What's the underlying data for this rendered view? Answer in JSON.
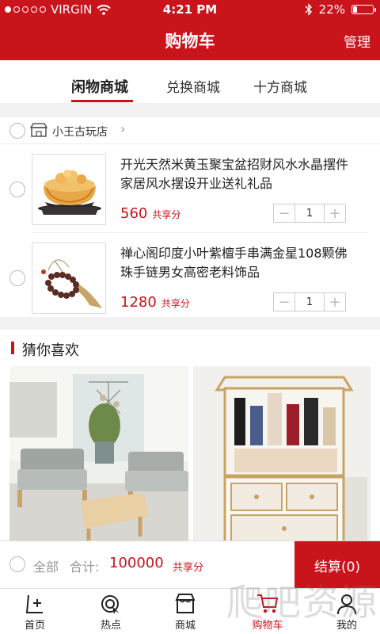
{
  "status_bar": {
    "carrier": "VIRGIN",
    "time": "4:21 PM",
    "battery": "22%",
    "battery_level": 0.22
  },
  "nav": {
    "title": "购物车",
    "manage_label": "管理"
  },
  "tabs": [
    {
      "label": "闲物商城",
      "active": true
    },
    {
      "label": "兑换商城",
      "active": false
    },
    {
      "label": "十方商城",
      "active": false
    }
  ],
  "shop": {
    "name": "小王古玩店",
    "icon": "store-icon"
  },
  "cart_items": [
    {
      "name": "开光天然米黄玉聚宝盆招财风水水晶摆件家居风水摆设开业送礼礼品",
      "price": "560",
      "share_label": "共享分",
      "quantity": "1"
    },
    {
      "name": "禅心阁印度小叶紫檀手串满金星108颗佛珠手链男女高密老料饰品",
      "price": "1280",
      "share_label": "共享分",
      "quantity": "1"
    }
  ],
  "recommend": {
    "title": "猜你喜欢"
  },
  "checkout": {
    "all_label": "全部",
    "total_label": "合计:",
    "total_value": "100000",
    "share_label": "共享分",
    "button_label": "结算(0)"
  },
  "tab_bar": [
    {
      "label": "首页",
      "icon": "home-icon"
    },
    {
      "label": "热点",
      "icon": "hot-icon"
    },
    {
      "label": "商城",
      "icon": "store-icon"
    },
    {
      "label": "购物车",
      "icon": "cart-icon",
      "active": true
    },
    {
      "label": "我的",
      "icon": "user-icon"
    }
  ],
  "watermark": "爬吧资源",
  "colors": {
    "brand_red": "#c9141c",
    "background": "#f2f2f2"
  }
}
